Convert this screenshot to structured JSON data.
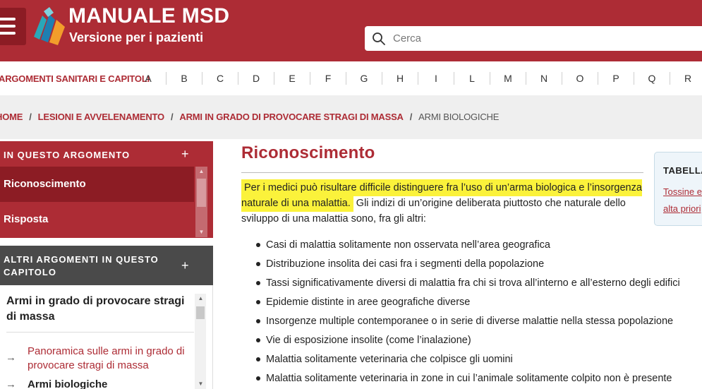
{
  "header": {
    "brand_title": "MANUALE MSD",
    "brand_subtitle": "Versione per i pazienti",
    "search_placeholder": "Cerca"
  },
  "alphabar": {
    "label": "ARGOMENTI SANITARI E CAPITOLI",
    "letters": [
      "A",
      "B",
      "C",
      "D",
      "E",
      "F",
      "G",
      "H",
      "I",
      "L",
      "M",
      "N",
      "O",
      "P",
      "Q",
      "R"
    ]
  },
  "breadcrumb": {
    "items": [
      "HOME",
      "LESIONI E AVVELENAMENTO",
      "ARMI IN GRADO DI PROVOCARE STRAGI DI MASSA"
    ],
    "current": "ARMI BIOLOGICHE",
    "separator": "/"
  },
  "sidebar": {
    "in_topic_title": "IN QUESTO ARGOMENTO",
    "in_topic_items": [
      "Riconoscimento",
      "Risposta"
    ],
    "other_topics_title": "ALTRI ARGOMENTI IN QUESTO CAPITOLO",
    "chapter_title": "Armi in grado di provocare stragi di massa",
    "chapter_items": [
      "Panoramica sulle armi in grado di provocare stragi di massa",
      "Armi biologiche"
    ],
    "arrow": "→",
    "plus": "+"
  },
  "main": {
    "title": "Riconoscimento",
    "highlight": "Per i medici può risultare difficile distinguere fra l’uso di un’arma biologica e l’insorgenza naturale di una malattia.",
    "after_highlight": " Gli indizi di un’origine deliberata piuttosto che naturale dello sviluppo di una malattia sono, fra gli altri:",
    "bullets": [
      "Casi di malattia solitamente non osservata nell’area geografica",
      "Distribuzione insolita dei casi fra i segmenti della popolazione",
      "Tassi significativamente diversi di malattia fra chi si trova all’interno e all’esterno degli edifici",
      "Epidemie distinte in aree geografiche diverse",
      "Insorgenze multiple contemporanee o in serie di diverse malattie nella stessa popolazione",
      "Vie di esposizione insolite (come l’inalazione)",
      "Malattia solitamente veterinaria che colpisce gli uomini",
      "Malattia solitamente veterinaria in zone in cui l’animale solitamente colpito non è presente"
    ]
  },
  "tablebox": {
    "title": "TABELLA",
    "link_lines": [
      "Tossine e",
      "alta priori"
    ]
  },
  "colors": {
    "brand": "#ad2c35",
    "brand_dark": "#8c1c24",
    "highlight": "#fbf23b"
  }
}
